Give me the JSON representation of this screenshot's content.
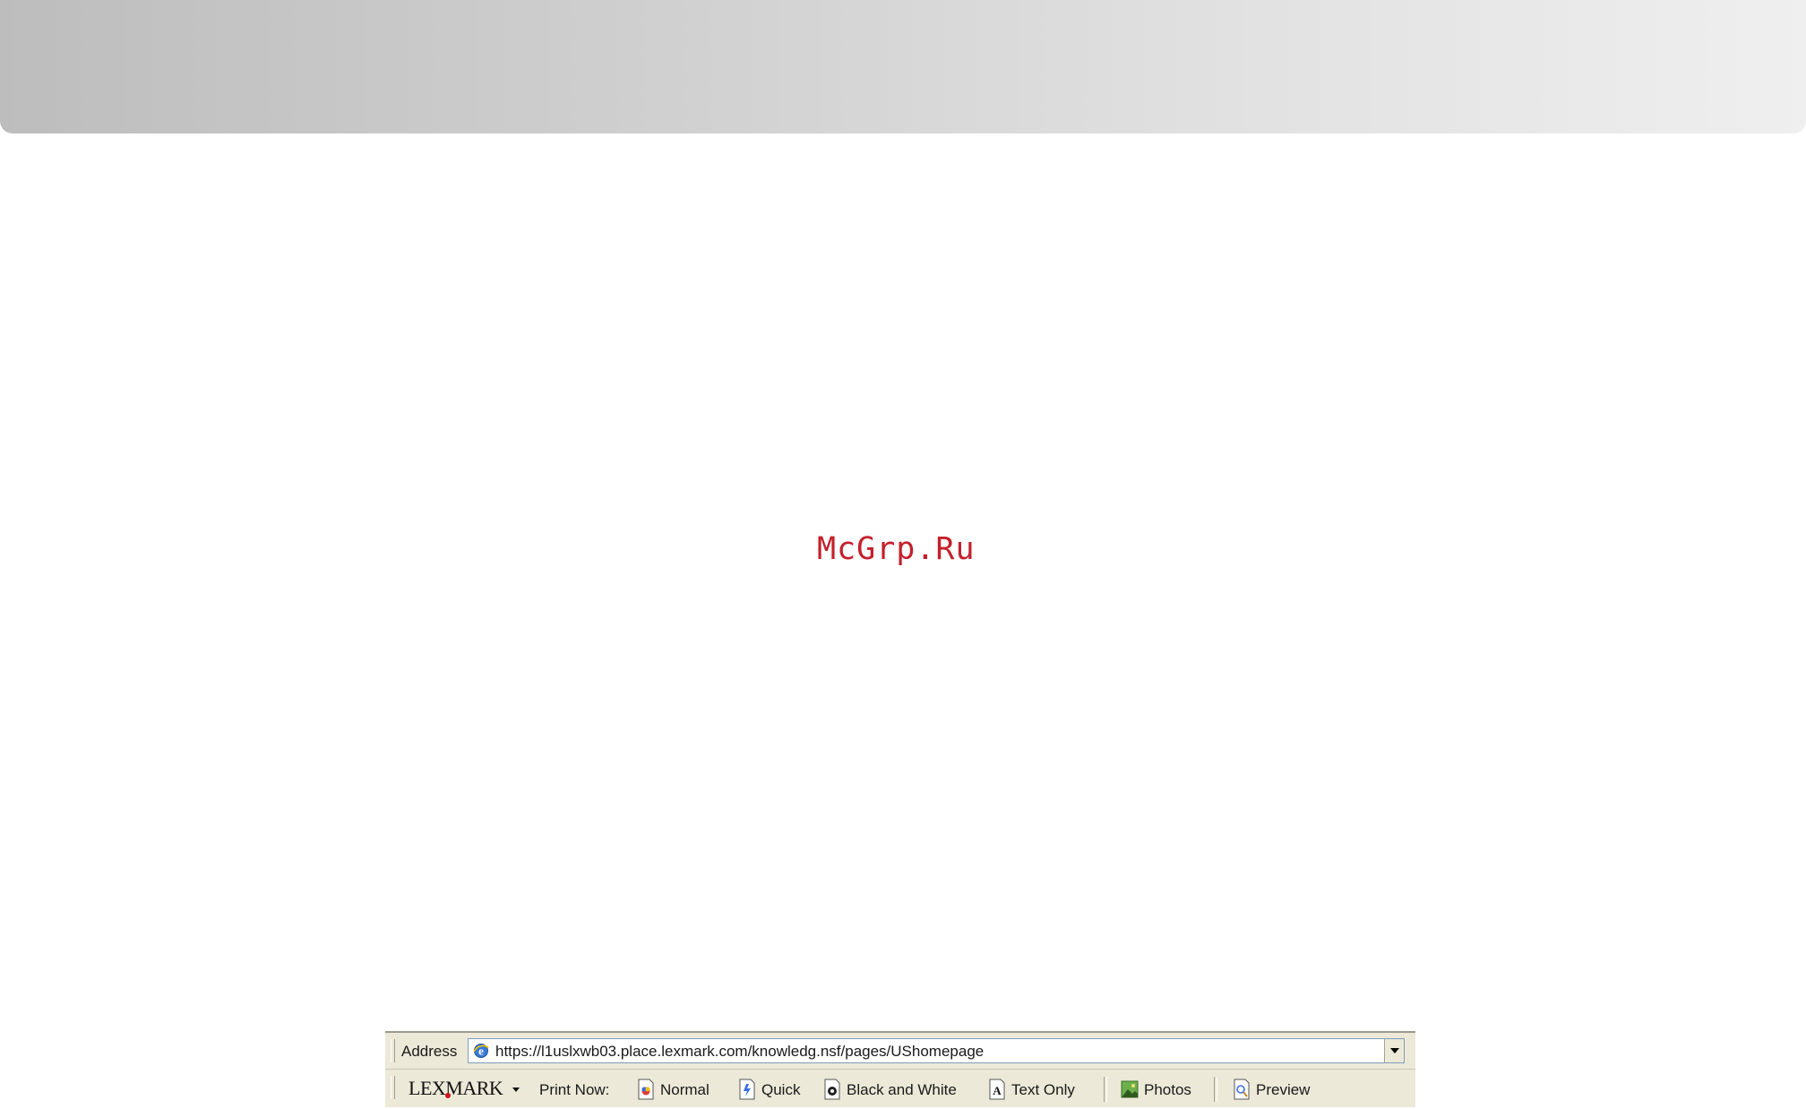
{
  "watermark": {
    "text": "McGrp.Ru"
  },
  "address_bar": {
    "label": "Address",
    "url": "https://l1uslxwb03.place.lexmark.com/knowledg.nsf/pages/UShomepage"
  },
  "lexmark_toolbar": {
    "logo_text": "LEXMARK",
    "print_now_label": "Print Now:",
    "buttons": [
      {
        "label": "Normal",
        "icon": "normal-print-icon"
      },
      {
        "label": "Quick",
        "icon": "quick-print-icon"
      },
      {
        "label": "Black and White",
        "icon": "black-white-print-icon"
      },
      {
        "label": "Text Only",
        "icon": "text-only-print-icon"
      },
      {
        "label": "Photos",
        "icon": "photos-print-icon"
      },
      {
        "label": "Preview",
        "icon": "preview-icon"
      }
    ]
  },
  "colors": {
    "toolbar_background": "#ece9d8",
    "watermark": "#c4202c",
    "logo_accent": "#d0141e"
  }
}
